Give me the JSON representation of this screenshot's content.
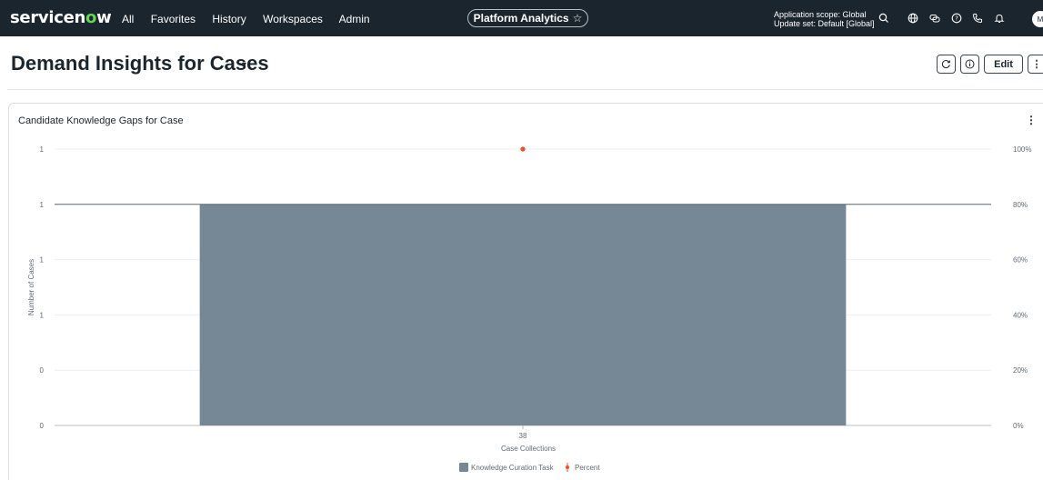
{
  "topnav": {
    "logo_a": "servicen",
    "logo_o": "o",
    "logo_b": "w",
    "items": [
      "All",
      "Favorites",
      "History",
      "Workspaces",
      "Admin"
    ],
    "center_title": "Platform Analytics",
    "star": "☆",
    "scope_line1": "Application scope: Global",
    "scope_line2": "Update set: Default [Global]",
    "icons": [
      "search-icon",
      "globe-icon",
      "chat-icon",
      "help-icon",
      "phone-icon",
      "bell-icon"
    ],
    "avatar": "M"
  },
  "page": {
    "title": "Demand Insights for Cases",
    "caret": "▾",
    "edit_label": "Edit",
    "more": "⋮"
  },
  "card": {
    "title": "Candidate Knowledge Gaps for Case",
    "menu": "⋮"
  },
  "colors": {
    "nav_bg": "#1b252d",
    "bar": "#768896",
    "percent": "#f04e23",
    "logo_accent": "#62d84e"
  },
  "chart_data": {
    "type": "bar",
    "categories": [
      "38"
    ],
    "series": [
      {
        "name": "Knowledge Curation Task",
        "type": "bar",
        "axis": "left",
        "values": [
          1
        ]
      },
      {
        "name": "Percent",
        "type": "line",
        "axis": "right",
        "values": [
          100
        ]
      }
    ],
    "xlabel": "Case Collections",
    "ylabel": "Number of Cases",
    "y_ticks": [
      "0",
      "0",
      "1",
      "1",
      "1",
      "1"
    ],
    "y2_ticks": [
      "0%",
      "20%",
      "40%",
      "60%",
      "80%",
      "100%"
    ],
    "ylim": [
      0,
      1.25
    ],
    "y2lim": [
      0,
      100
    ],
    "grid": true,
    "legend": "bottom-center"
  }
}
